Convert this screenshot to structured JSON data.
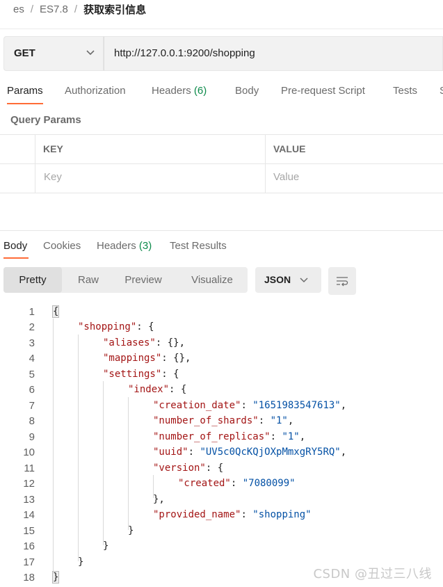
{
  "breadcrumb": {
    "items": [
      "es",
      "ES7.8",
      "获取索引信息"
    ],
    "separator": "/"
  },
  "request": {
    "method": "GET",
    "url": "http://127.0.0.1:9200/shopping",
    "tabs": [
      {
        "label": "Params",
        "active": true
      },
      {
        "label": "Authorization"
      },
      {
        "label": "Headers",
        "count": "(6)"
      },
      {
        "label": "Body"
      },
      {
        "label": "Pre-request Script"
      },
      {
        "label": "Tests"
      },
      {
        "label": "S"
      }
    ],
    "query_params_title": "Query Params",
    "table": {
      "key_header": "KEY",
      "value_header": "VALUE",
      "key_placeholder": "Key",
      "value_placeholder": "Value"
    }
  },
  "response": {
    "tabs": [
      {
        "label": "Body",
        "active": true
      },
      {
        "label": "Cookies"
      },
      {
        "label": "Headers",
        "count": "(3)"
      },
      {
        "label": "Test Results"
      }
    ],
    "formats": [
      "Pretty",
      "Raw",
      "Preview",
      "Visualize"
    ],
    "active_format": "Pretty",
    "language": "JSON",
    "lines": [
      {
        "n": "1",
        "text": "{"
      },
      {
        "n": "2",
        "text": "\"shopping\": {"
      },
      {
        "n": "3",
        "text": "\"aliases\": {},"
      },
      {
        "n": "4",
        "text": "\"mappings\": {},"
      },
      {
        "n": "5",
        "text": "\"settings\": {"
      },
      {
        "n": "6",
        "text": "\"index\": {"
      },
      {
        "n": "7",
        "text": "\"creation_date\": \"1651983547613\","
      },
      {
        "n": "8",
        "text": "\"number_of_shards\": \"1\","
      },
      {
        "n": "9",
        "text": "\"number_of_replicas\": \"1\","
      },
      {
        "n": "10",
        "text": "\"uuid\": \"UV5c0QcKQjOXpMmxgRY5RQ\","
      },
      {
        "n": "11",
        "text": "\"version\": {"
      },
      {
        "n": "12",
        "text": "\"created\": \"7080099\""
      },
      {
        "n": "13",
        "text": "},"
      },
      {
        "n": "14",
        "text": "\"provided_name\": \"shopping\""
      },
      {
        "n": "15",
        "text": "}"
      },
      {
        "n": "16",
        "text": "}"
      },
      {
        "n": "17",
        "text": "}"
      },
      {
        "n": "18",
        "text": "}"
      }
    ]
  },
  "watermark": "CSDN @丑过三八线",
  "colors": {
    "accent": "#ff6c37",
    "count_green": "#0c8a4a",
    "json_key": "#a31515",
    "json_string": "#0451a5"
  },
  "icons": {
    "method_dropdown": "chevron-down-icon",
    "format_dropdown": "chevron-down-icon",
    "wrap": "wrap-lines-icon"
  }
}
